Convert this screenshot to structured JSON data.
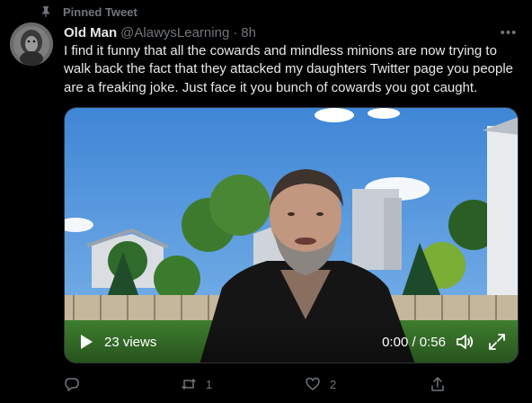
{
  "pinned": {
    "label": "Pinned Tweet",
    "icon": "pin-icon"
  },
  "tweet": {
    "author_name": "Old Man",
    "author_handle": "@AlawysLearning",
    "separator": "·",
    "timestamp": "8h",
    "more_label": "•••",
    "text": "I find it funny that all the cowards and mindless minions are now trying to walk back the fact that they attacked my daughters Twitter page you people are a freaking joke. Just face it you bunch of cowards you got caught."
  },
  "video": {
    "views": "23 views",
    "time": "0:00 / 0:56",
    "icons": [
      "play-icon",
      "volume-icon",
      "fullscreen-icon"
    ]
  },
  "actions": {
    "reply_count": "",
    "retweet_count": "1",
    "like_count": "2",
    "icons": [
      "reply-icon",
      "retweet-icon",
      "like-icon",
      "share-icon"
    ]
  },
  "colors": {
    "background": "#000000",
    "text": "#e7e9ea",
    "muted": "#71767b"
  }
}
